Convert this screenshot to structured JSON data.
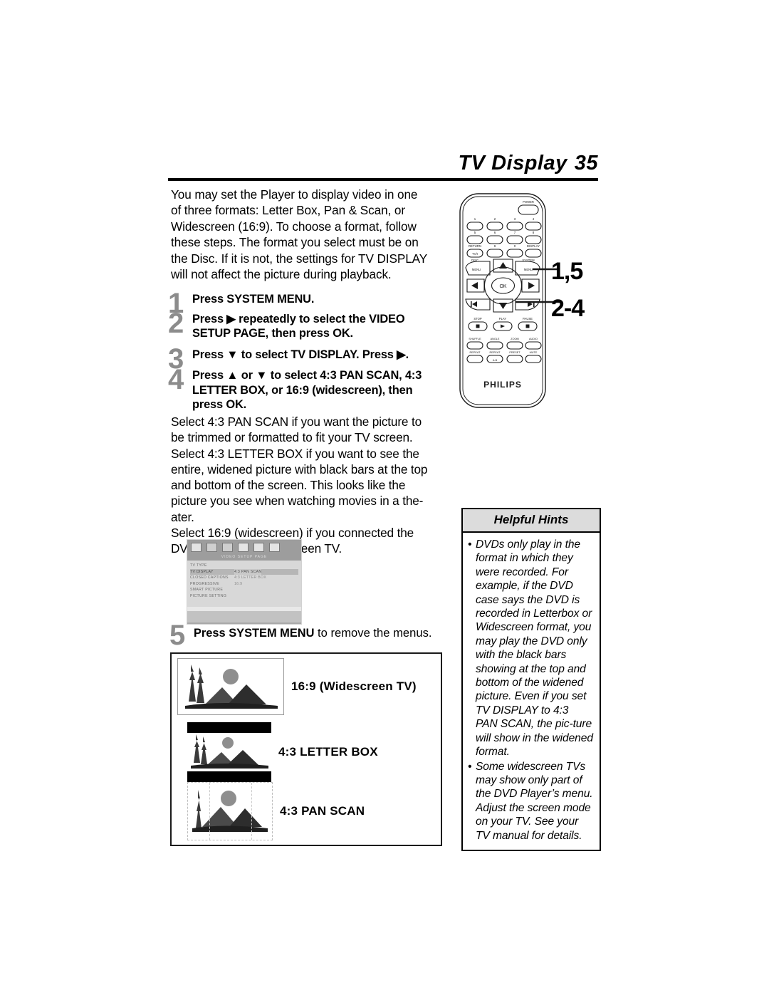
{
  "header": {
    "title": "TV Display",
    "page_number": "35"
  },
  "intro": "You may set the Player to display video in one of three formats: Letter Box, Pan & Scan, or Widescreen (16:9). To choose a format, follow these steps. The format you select must be on the Disc.  If it is not, the settings for TV DISPLAY will not affect the picture during playback.",
  "steps": [
    {
      "num": "1",
      "text": "Press SYSTEM MENU."
    },
    {
      "num": "2",
      "text": "Press ▶ repeatedly to select the VIDEO SETUP PAGE, then press OK."
    },
    {
      "num": "3",
      "text": "Press ▼ to select TV DISPLAY.  Press ▶."
    },
    {
      "num": "4",
      "text": "Press ▲ or ▼ to select 4:3 PAN SCAN, 4:3 LETTER BOX, or 16:9 (widescreen), then press OK."
    }
  ],
  "body_paragraphs": [
    "Select 4:3 PAN SCAN if you want the picture to be trimmed or formatted to fit your TV screen.",
    "Select 4:3 LETTER BOX if you want to see the entire, widened picture with black bars at the top and bottom of the screen. This looks like the picture you see when watching movies in a the-ater.",
    "Select 16:9 (widescreen) if you connected the DVD Player to a widescreen TV."
  ],
  "step5": {
    "num": "5",
    "bold": "Press SYSTEM MENU",
    "light": " to remove the menus."
  },
  "osd": {
    "page_title": "VIDEO SETUP PAGE",
    "rows": [
      {
        "label": "TV TYPE",
        "value": ""
      },
      {
        "label": "TV DISPLAY",
        "value": "4:3 PAN SCAN"
      },
      {
        "label": "CLOSED CAPTIONS",
        "value": "4:3 LETTER BOX"
      },
      {
        "label": "PROGRESSIVE",
        "value": "16:9"
      },
      {
        "label": "SMART PICTURE",
        "value": ""
      },
      {
        "label": "PICTURE SETTING",
        "value": ""
      }
    ],
    "selected_index": 1,
    "icons": [
      "general-setup-icon",
      "audio-setup-icon",
      "video-setup-icon",
      "preference-setup-icon",
      "password-setup-icon",
      "exit-setup-icon"
    ]
  },
  "formats": [
    {
      "id": "widescreen",
      "label": "16:9 (Widescreen TV)"
    },
    {
      "id": "letterbox",
      "label": "4:3 LETTER BOX"
    },
    {
      "id": "panscan",
      "label": "4:3 PAN SCAN"
    }
  ],
  "hints": {
    "title": "Helpful Hints",
    "items": [
      "DVDs only play in the format in which they were recorded. For example, if the DVD case says the DVD is recorded in Letterbox or Widescreen format, you may play the DVD only with the black bars showing at the top and bottom of the widened picture. Even if you set  TV DISPLAY to 4:3 PAN SCAN, the pic-ture will show in the widened format.",
      "Some widescreen TVs may show only part of the DVD Player’s menu. Adjust the screen mode on your TV. See your TV manual for details."
    ],
    "bullet": "•"
  },
  "remote": {
    "brand": "PHILIPS",
    "callouts": [
      {
        "id": "system-menu",
        "text": "1,5"
      },
      {
        "id": "navigation-ok",
        "text": "2-4"
      }
    ],
    "labels": {
      "power": "POWER",
      "return": "RETURN",
      "tv": "TV/I",
      "display": "DISPLAY",
      "disc_menu_top": "DISC",
      "disc_menu": "MENU",
      "system_menu_top": "SYSTEM",
      "system_menu": "MENU",
      "ok": "OK",
      "stop": "STOP",
      "play": "PLAY",
      "pause": "PAUSE",
      "shuffle": "SHUFFLE",
      "angle": "ANGLE",
      "zoom": "ZOOM",
      "audio": "AUDIO",
      "repeat": "REPEAT",
      "repeat_ab_top": "REPEAT",
      "repeat_ab": "A-B",
      "preset": "PRESET",
      "mute": "MUTE"
    },
    "keypad": [
      "1",
      "2",
      "3",
      "4",
      "5",
      "6",
      "7",
      "8",
      "9",
      "0"
    ]
  },
  "colors": {
    "step_number": "#8c8c8c",
    "rule": "#000000",
    "hints_title_bg": "#dcdcdc",
    "text": "#000000"
  }
}
